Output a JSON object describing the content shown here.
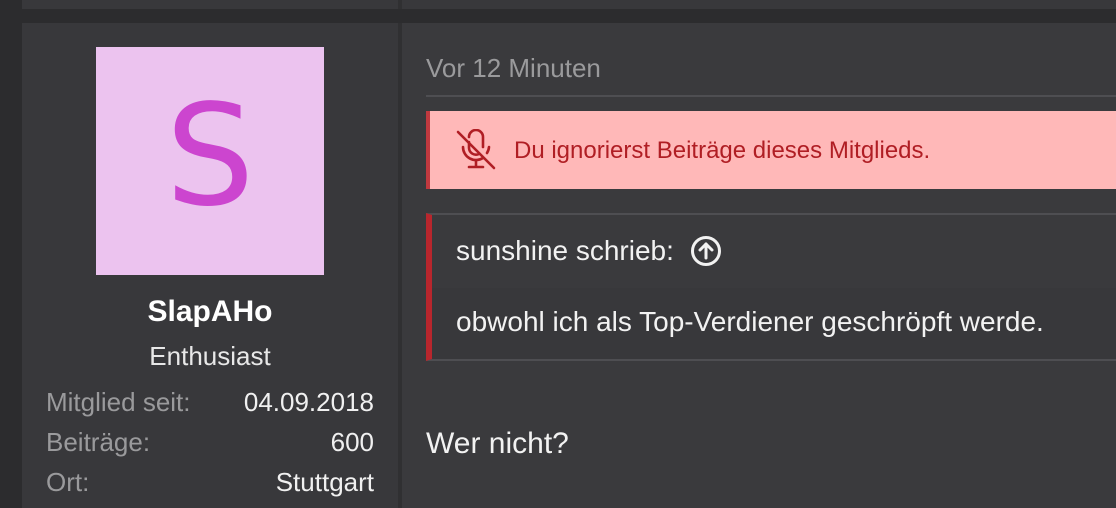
{
  "author": {
    "avatar_letter": "S",
    "avatar_bg": "#ecc3ef",
    "avatar_fg": "#cc45cf",
    "username": "SlapAHo",
    "title": "Enthusiast",
    "stats": [
      {
        "label": "Mitglied seit:",
        "value": "04.09.2018"
      },
      {
        "label": "Beiträge:",
        "value": "600"
      },
      {
        "label": "Ort:",
        "value": "Stuttgart"
      }
    ]
  },
  "post": {
    "date": "Vor 12 Minuten",
    "ignored_notice": {
      "icon": "muted-microphone-icon",
      "text": "Du ignorierst Beiträge dieses Mitglieds.",
      "bg": "#ffb8b8",
      "color": "#b01e24"
    },
    "quote": {
      "header": "sunshine schrieb:",
      "jump_icon": "arrow-up-circle-icon",
      "text": "obwohl ich als Top-Verdiener geschröpft werde.",
      "accent": "#b8262d"
    },
    "body": "Wer nicht?"
  }
}
